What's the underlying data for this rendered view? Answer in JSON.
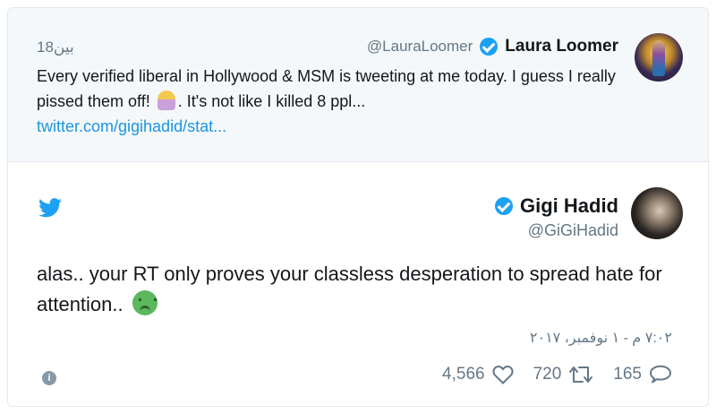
{
  "quoted_tweet": {
    "display_name": "Laura Loomer",
    "handle": "@LauraLoomer",
    "time": "18بين",
    "text_before_emoji": "Every verified liberal in Hollywood & MSM is tweeting at me today. I guess I really pissed them off!",
    "text_after_emoji": ". It's not like I killed 8 ppl...",
    "link": "twitter.com/gigihadid/stat..."
  },
  "tweet": {
    "display_name": "Gigi Hadid",
    "handle": "@GiGiHadid",
    "text": "alas.. your RT only proves your classless desperation to spread hate for attention..",
    "date": "٧:٠٢ م - ١ نوفمبر، ٢٠١٧"
  },
  "actions": {
    "likes": "4,566",
    "retweets": "720",
    "replies": "165"
  },
  "icons": {
    "verified": "verified-badge-icon",
    "bird": "twitter-bird-icon",
    "info": "info-icon",
    "like": "heart-icon",
    "retweet": "retweet-icon",
    "reply": "reply-icon"
  },
  "colors": {
    "verified_blue": "#1da1f2",
    "link_blue": "#1b95e0",
    "muted": "#657786",
    "quoted_bg": "#f5f8fa"
  }
}
